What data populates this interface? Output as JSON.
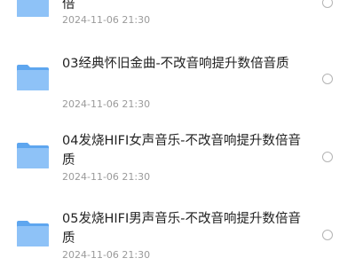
{
  "files": [
    {
      "name": "倍",
      "date": "2024-11-06 21:30",
      "icon": "folder-icon"
    },
    {
      "name": "03经典怀旧金曲-不改音响提升数倍音质",
      "date": "2024-11-06 21:30",
      "icon": "folder-icon"
    },
    {
      "name": "04发烧HIFI女声音乐-不改音响提升数倍音质",
      "date": "2024-11-06 21:30",
      "icon": "folder-icon"
    },
    {
      "name": "05发烧HIFI男声音乐-不改音响提升数倍音质",
      "date": "2024-11-06 21:30",
      "icon": "folder-icon"
    }
  ],
  "colors": {
    "folder_front": "#8ec2f7",
    "folder_back": "#5ea6ef",
    "text": "#222222",
    "date": "#9a9a9a"
  }
}
